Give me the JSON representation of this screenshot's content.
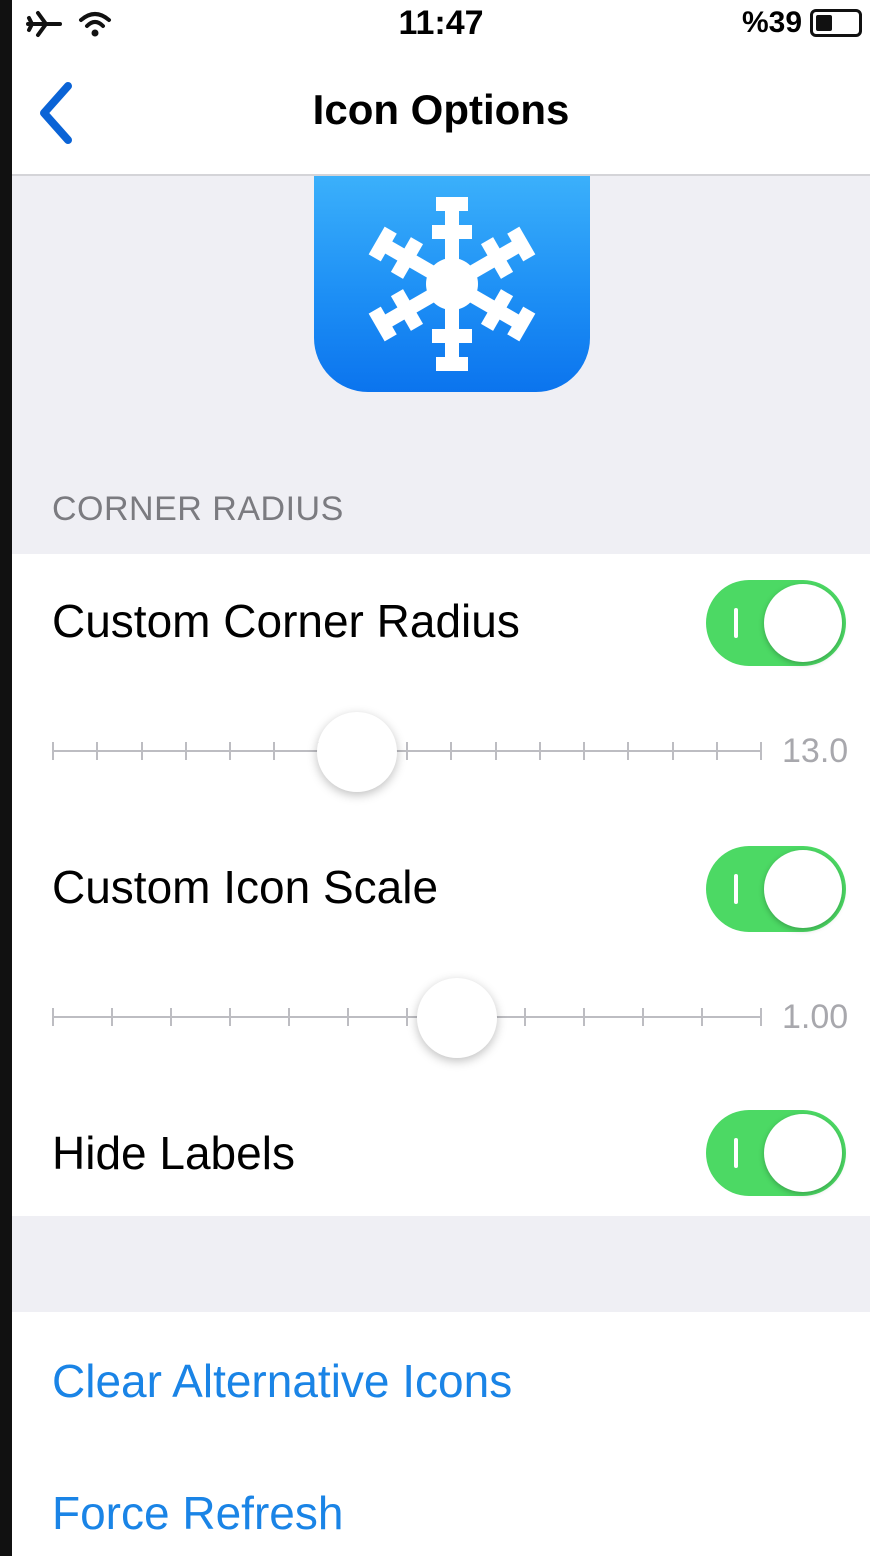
{
  "status_bar": {
    "time": "11:47",
    "battery_text": "%39",
    "battery_level": 0.39,
    "icons": [
      "airplane-icon",
      "wifi-icon",
      "battery-icon"
    ]
  },
  "nav": {
    "title": "Icon Options",
    "back_icon": "chevron-left-icon"
  },
  "preview": {
    "icon": "snowflake-icon"
  },
  "section": {
    "header": "CORNER RADIUS"
  },
  "settings": {
    "custom_corner_radius": {
      "label": "Custom Corner Radius",
      "enabled": true,
      "slider_value_text": "13.0",
      "slider_fraction": 0.43
    },
    "custom_icon_scale": {
      "label": "Custom Icon Scale",
      "enabled": true,
      "slider_value_text": "1.00",
      "slider_fraction": 0.57
    },
    "hide_labels": {
      "label": "Hide Labels",
      "enabled": true
    }
  },
  "actions": {
    "clear_alternative_icons": "Clear Alternative Icons",
    "force_refresh": "Force Refresh"
  },
  "colors": {
    "accent_blue": "#1a84e6",
    "toggle_on": "#4cd964",
    "group_bg": "#efeff4",
    "icon_gradient_top": "#3bb0fb",
    "icon_gradient_bottom": "#0b74ee"
  }
}
